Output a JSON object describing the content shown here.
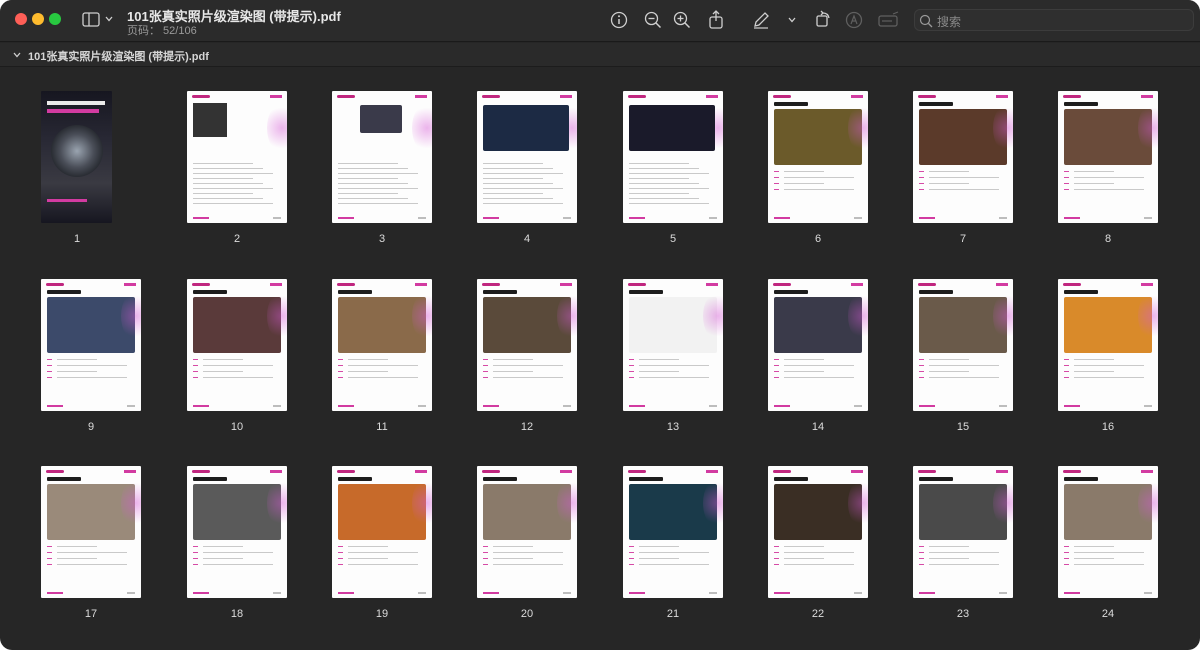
{
  "window": {
    "title": "101张真实照片级渲染图 (带提示).pdf",
    "subtitle": "页码： 52/106"
  },
  "toolbar": {
    "icons": [
      "sidebar-icon",
      "chevron-down-icon",
      "info-icon",
      "zoom-out-icon",
      "zoom-in-icon",
      "share-icon",
      "markup-pen-icon",
      "chevron-down-icon",
      "rotate-icon",
      "highlight-icon",
      "annotate-icon"
    ],
    "search_placeholder": "搜索"
  },
  "sidebar": {
    "file_label": "101张真实照片级渲染图 (带提示).pdf"
  },
  "thumbnails": [
    {
      "num": "1",
      "kind": "cover",
      "color": "#2a2a30"
    },
    {
      "num": "2",
      "kind": "text",
      "color": "#333333"
    },
    {
      "num": "3",
      "kind": "text",
      "color": "#3a3a4a"
    },
    {
      "num": "4",
      "kind": "text",
      "color": "#1c2a44"
    },
    {
      "num": "5",
      "kind": "text",
      "color": "#1a1a2a"
    },
    {
      "num": "6",
      "kind": "photo",
      "color": "#6b5a2a"
    },
    {
      "num": "7",
      "kind": "photo",
      "color": "#5b3a2a"
    },
    {
      "num": "8",
      "kind": "photo",
      "color": "#6a4b3a"
    },
    {
      "num": "9",
      "kind": "photo",
      "color": "#3c4a6a"
    },
    {
      "num": "10",
      "kind": "photo",
      "color": "#5a3a3a"
    },
    {
      "num": "11",
      "kind": "photo",
      "color": "#8a6a4a"
    },
    {
      "num": "12",
      "kind": "photo",
      "color": "#5a4a3a"
    },
    {
      "num": "13",
      "kind": "photo",
      "color": "#f2f2f2"
    },
    {
      "num": "14",
      "kind": "photo",
      "color": "#3a3a4a"
    },
    {
      "num": "15",
      "kind": "photo",
      "color": "#6a5a4a"
    },
    {
      "num": "16",
      "kind": "photo",
      "color": "#d98a2a"
    },
    {
      "num": "17",
      "kind": "photo",
      "color": "#9a8a7a"
    },
    {
      "num": "18",
      "kind": "photo",
      "color": "#5a5a5a"
    },
    {
      "num": "19",
      "kind": "photo",
      "color": "#c76a2a"
    },
    {
      "num": "20",
      "kind": "photo",
      "color": "#8a7a6a"
    },
    {
      "num": "21",
      "kind": "photo",
      "color": "#1a3a4a"
    },
    {
      "num": "22",
      "kind": "photo",
      "color": "#3a2e24"
    },
    {
      "num": "23",
      "kind": "photo",
      "color": "#4a4a4a"
    },
    {
      "num": "24",
      "kind": "photo",
      "color": "#8a7a6a"
    }
  ],
  "colors": {
    "window_bg": "#262626",
    "titlebar_bg": "#2b2b2b",
    "accent_pink": "#d23ba1"
  }
}
